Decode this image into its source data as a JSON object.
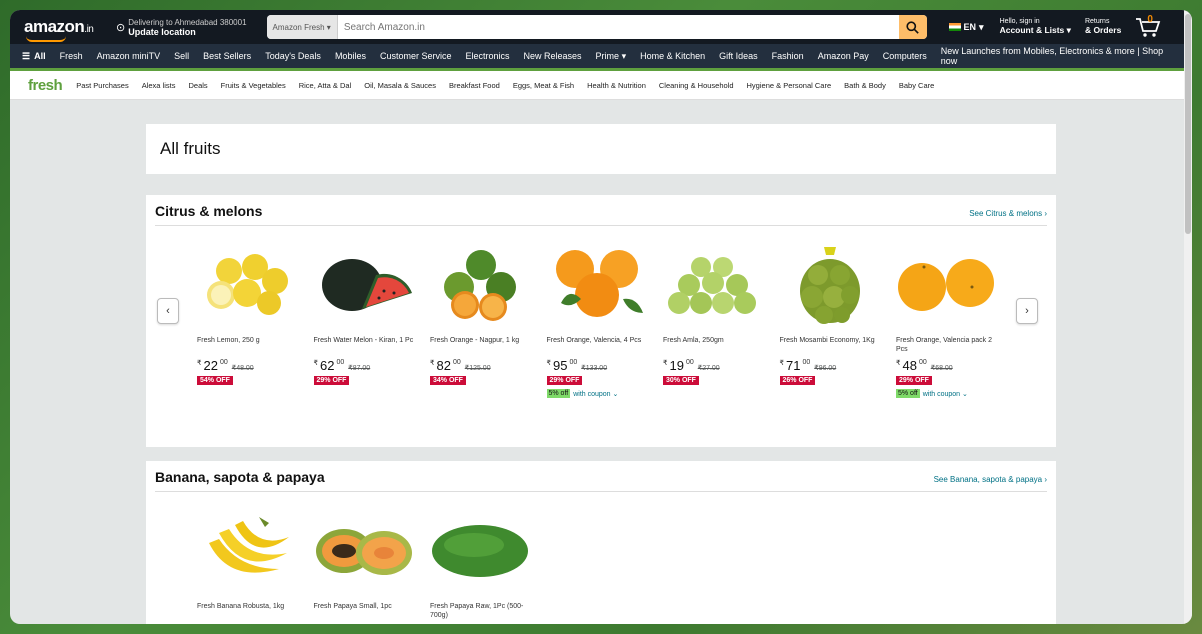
{
  "header": {
    "logo": "amazon",
    "logo_suffix": ".in",
    "deliver_line1": "Delivering to Ahmedabad 380001",
    "deliver_line2": "Update location",
    "search_category": "Amazon Fresh",
    "search_placeholder": "Search Amazon.in",
    "lang": "EN",
    "account_line1": "Hello, sign in",
    "account_line2": "Account & Lists",
    "orders_line1": "Returns",
    "orders_line2": "& Orders",
    "cart_count": "0"
  },
  "subnav": {
    "all": "All",
    "items": [
      "Fresh",
      "Amazon miniTV",
      "Sell",
      "Best Sellers",
      "Today's Deals",
      "Mobiles",
      "Customer Service",
      "Electronics",
      "New Releases",
      "Prime",
      "Home & Kitchen",
      "Gift Ideas",
      "Fashion",
      "Amazon Pay",
      "Computers"
    ],
    "promo": "New Launches from Mobiles, Electronics & more | Shop now"
  },
  "freshnav": {
    "logo": "fresh",
    "items": [
      "Past Purchases",
      "Alexa lists",
      "Deals",
      "Fruits & Vegetables",
      "Rice, Atta & Dal",
      "Oil, Masala & Sauces",
      "Breakfast Food",
      "Eggs, Meat & Fish",
      "Health & Nutrition",
      "Cleaning & Household",
      "Hygiene & Personal Care",
      "Bath & Body",
      "Baby Care"
    ]
  },
  "page_title": "All fruits",
  "sections": [
    {
      "title": "Citrus & melons",
      "see_link": "See Citrus & melons ›",
      "products": [
        {
          "name": "Fresh Lemon, 250 g",
          "whole": "22",
          "frac": "00",
          "mrp": "₹48.00",
          "off": "54% OFF",
          "coupon": "",
          "image": "lemon"
        },
        {
          "name": "Fresh Water Melon - Kiran, 1 Pc",
          "whole": "62",
          "frac": "00",
          "mrp": "₹87.00",
          "off": "29% OFF",
          "coupon": "",
          "image": "watermelon"
        },
        {
          "name": "Fresh Orange - Nagpur, 1 kg",
          "whole": "82",
          "frac": "00",
          "mrp": "₹125.00",
          "off": "34% OFF",
          "coupon": "",
          "image": "green-orange"
        },
        {
          "name": "Fresh Orange, Valencia, 4 Pcs",
          "whole": "95",
          "frac": "00",
          "mrp": "₹133.00",
          "off": "29% OFF",
          "coupon": "5% off",
          "image": "orange"
        },
        {
          "name": "Fresh Amla, 250gm",
          "whole": "19",
          "frac": "00",
          "mrp": "₹27.00",
          "off": "30% OFF",
          "coupon": "",
          "image": "amla"
        },
        {
          "name": "Fresh Mosambi Economy, 1Kg",
          "whole": "71",
          "frac": "00",
          "mrp": "₹96.00",
          "off": "26% OFF",
          "coupon": "",
          "image": "mosambi"
        },
        {
          "name": "Fresh Orange, Valencia pack 2 Pcs",
          "whole": "48",
          "frac": "00",
          "mrp": "₹68.00",
          "off": "29% OFF",
          "coupon": "5% off",
          "image": "orange-2"
        }
      ]
    },
    {
      "title": "Banana, sapota & papaya",
      "see_link": "See Banana, sapota & papaya ›",
      "products": [
        {
          "name": "Fresh Banana Robusta, 1kg",
          "image": "banana"
        },
        {
          "name": "Fresh Papaya Small, 1pc",
          "image": "papaya-cut"
        },
        {
          "name": "Fresh Papaya Raw, 1Pc (500-700g)",
          "image": "papaya-raw"
        }
      ]
    }
  ],
  "labels": {
    "rupee": "₹",
    "with_coupon": "with coupon ⌄"
  },
  "colors": {
    "nav_dark": "#131921",
    "nav_sub": "#232f3e",
    "fresh_green": "#5ea03e",
    "search_btn": "#febd69",
    "discount_red": "#cc0c39",
    "link_teal": "#007185"
  }
}
